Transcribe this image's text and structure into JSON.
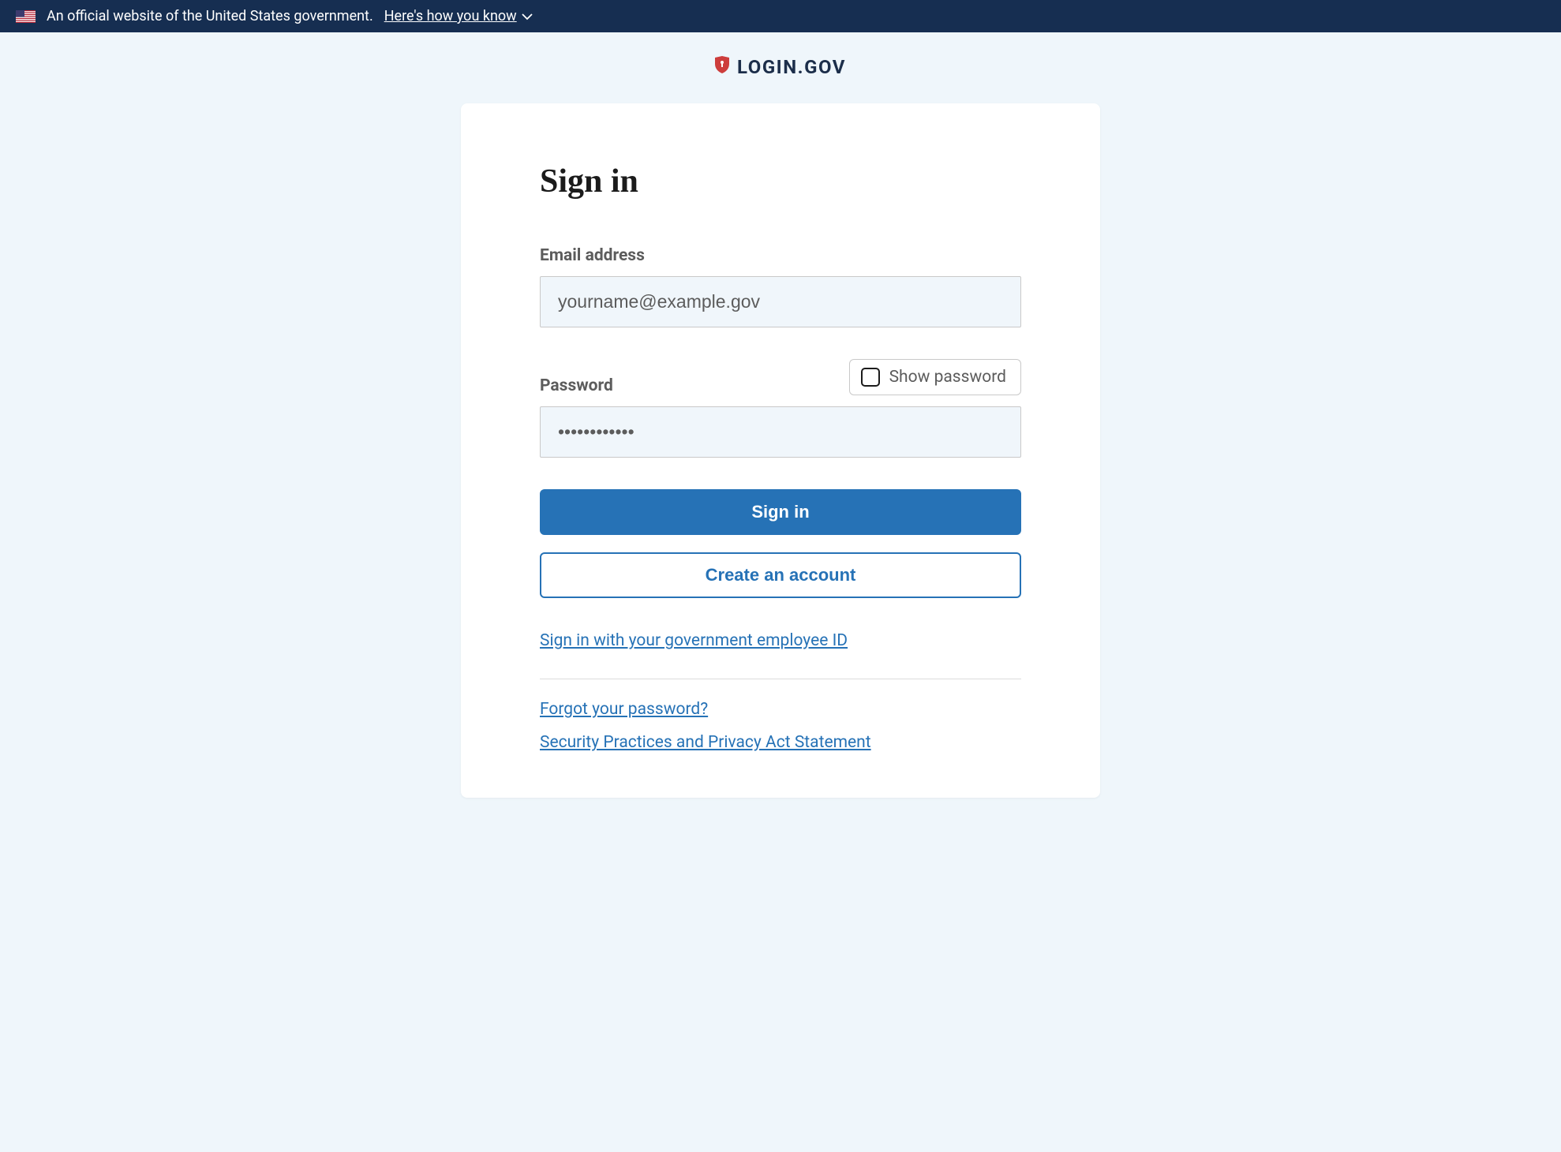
{
  "banner": {
    "text": "An official website of the United States government.",
    "link_text": "Here's how you know"
  },
  "brand": {
    "name": "LOGIN.GOV"
  },
  "form": {
    "title": "Sign in",
    "email_label": "Email address",
    "email_value": "yourname@example.gov",
    "password_label": "Password",
    "password_value": "••••••••••••",
    "show_password_label": "Show password",
    "sign_in_button": "Sign in",
    "create_account_button": "Create an account"
  },
  "links": {
    "gov_employee": "Sign in with your government employee ID",
    "forgot_password": "Forgot your password?",
    "security_statement": "Security Practices and Privacy Act Statement"
  }
}
